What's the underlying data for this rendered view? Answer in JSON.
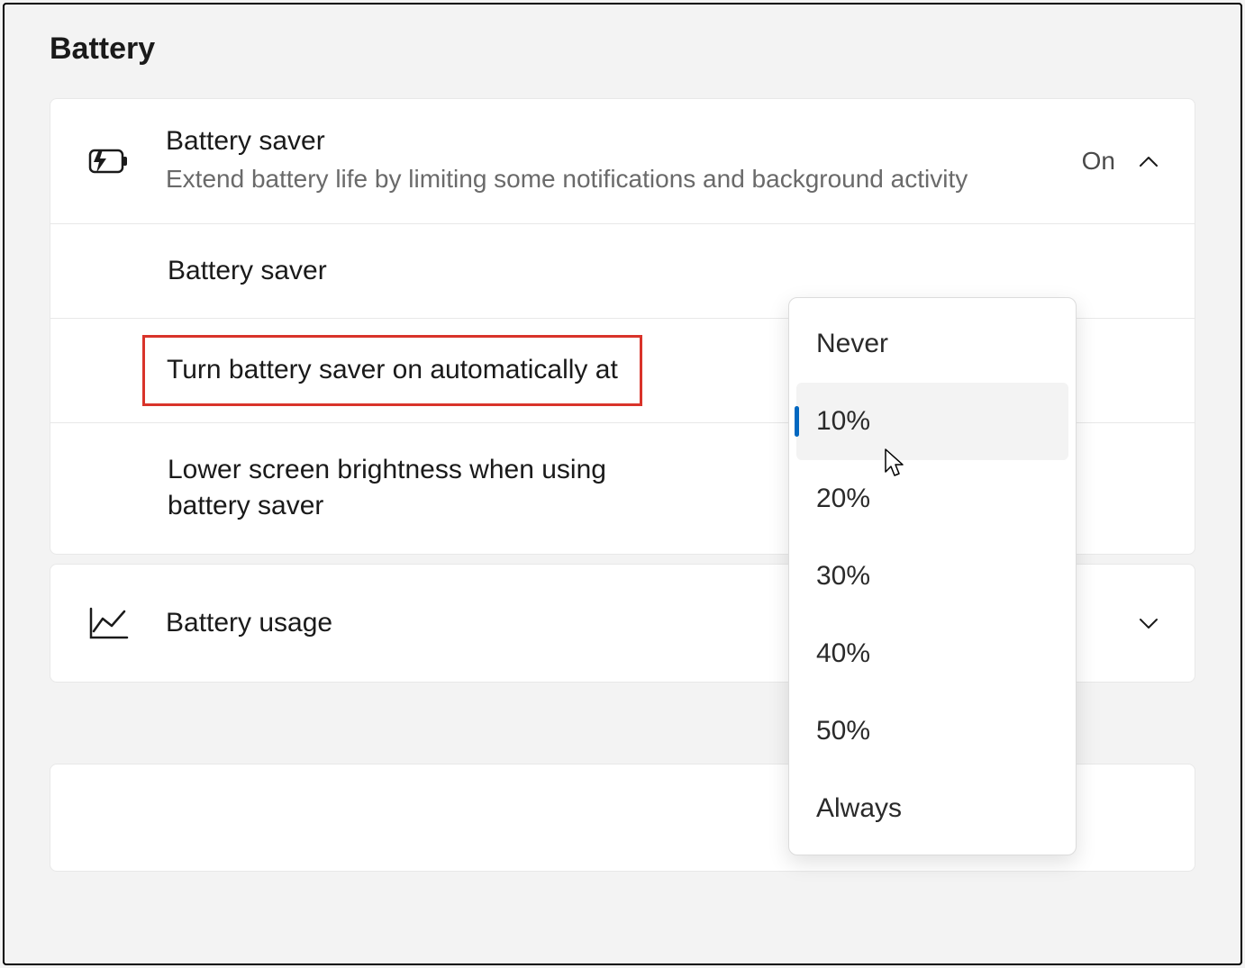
{
  "section_title": "Battery",
  "battery_saver": {
    "title": "Battery saver",
    "subtitle": "Extend battery life by limiting some notifications and background activity",
    "state": "On",
    "rows": {
      "toggle_label": "Battery saver",
      "auto_on_label": "Turn battery saver on automatically at",
      "lower_brightness_label": "Lower screen brightness when using battery saver"
    }
  },
  "battery_usage": {
    "title": "Battery usage"
  },
  "dropdown": {
    "options": [
      "Never",
      "10%",
      "20%",
      "30%",
      "40%",
      "50%",
      "Always"
    ],
    "selected_index": 1
  }
}
